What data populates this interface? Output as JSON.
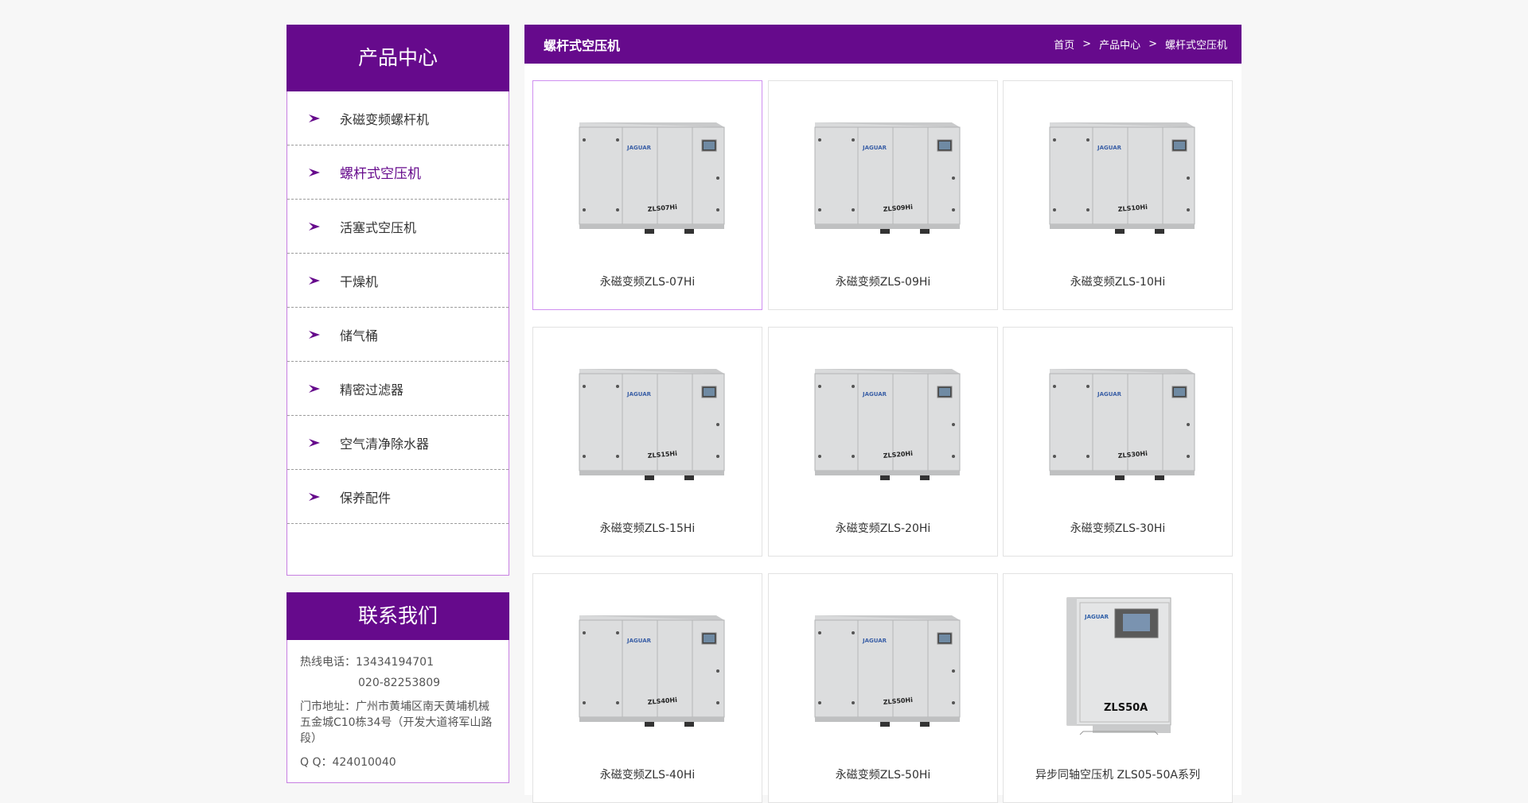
{
  "sidebar": {
    "title": "产品中心",
    "items": [
      {
        "label": "永磁变频螺杆机"
      },
      {
        "label": "螺杆式空压机"
      },
      {
        "label": "活塞式空压机"
      },
      {
        "label": "干燥机"
      },
      {
        "label": "储气桶"
      },
      {
        "label": "精密过滤器"
      },
      {
        "label": "空气清净除水器"
      },
      {
        "label": "保养配件"
      }
    ],
    "active_index": 1
  },
  "contact": {
    "title": "联系我们",
    "hotline_label": "热线电话：",
    "hotline_1": "13434194701",
    "hotline_2": "020-82253809",
    "address": "门市地址：广州市黄埔区南天黄埔机械五金城C10栋34号（开发大道将军山路段）",
    "qq": "Q  Q：424010040"
  },
  "main": {
    "title": "螺杆式空压机",
    "breadcrumb": [
      "首页",
      "产品中心",
      "螺杆式空压机"
    ],
    "breadcrumb_sep": ">",
    "products": [
      {
        "name": "永磁变频ZLS-07Hi",
        "model_text": "ZLS07Hi",
        "image": "cabinet"
      },
      {
        "name": "永磁变频ZLS-09Hi",
        "model_text": "ZLS09Hi",
        "image": "cabinet"
      },
      {
        "name": "永磁变频ZLS-10Hi",
        "model_text": "ZLS10Hi",
        "image": "cabinet"
      },
      {
        "name": "永磁变频ZLS-15Hi",
        "model_text": "ZLS15Hi",
        "image": "cabinet"
      },
      {
        "name": "永磁变频ZLS-20Hi",
        "model_text": "ZLS20Hi",
        "image": "cabinet"
      },
      {
        "name": "永磁变频ZLS-30Hi",
        "model_text": "ZLS30Hi",
        "image": "cabinet"
      },
      {
        "name": "永磁变频ZLS-40Hi",
        "model_text": "ZLS40Hi",
        "image": "cabinet"
      },
      {
        "name": "永磁变频ZLS-50Hi",
        "model_text": "ZLS50Hi",
        "image": "cabinet"
      },
      {
        "name": "异步同轴空压机 ZLS05-50A系列",
        "model_text": "ZLS50A",
        "image": "upright"
      }
    ]
  },
  "colors": {
    "brand": "#660a8c",
    "border_accent": "#c77fe2"
  }
}
